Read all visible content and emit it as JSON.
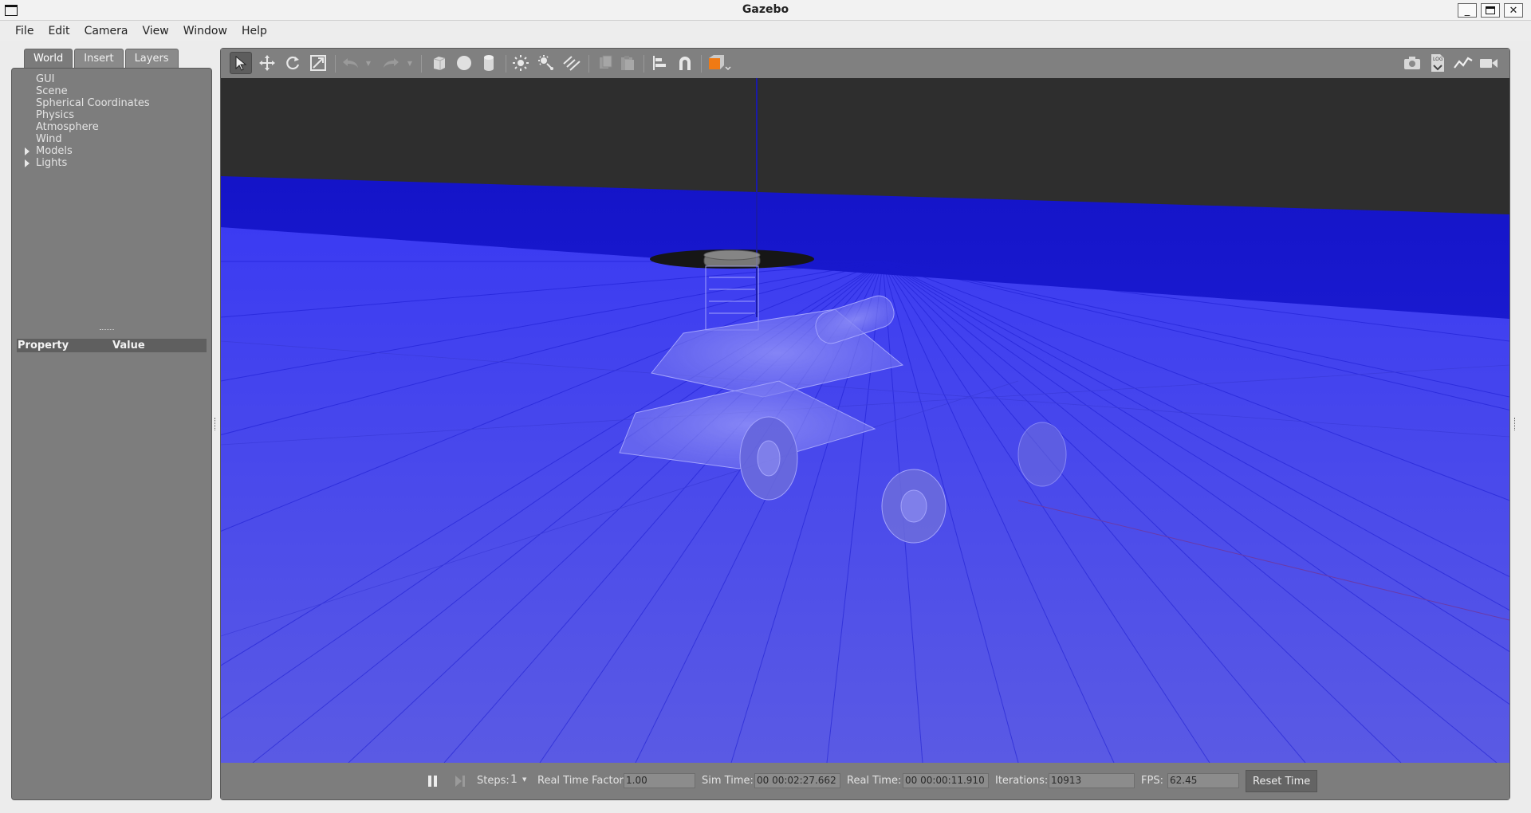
{
  "window": {
    "title": "Gazebo"
  },
  "menubar": {
    "items": [
      "File",
      "Edit",
      "Camera",
      "View",
      "Window",
      "Help"
    ]
  },
  "left_panel": {
    "tabs": [
      "World",
      "Insert",
      "Layers"
    ],
    "active_tab": "World",
    "tree": [
      "GUI",
      "Scene",
      "Spherical Coordinates",
      "Physics",
      "Atmosphere",
      "Wind",
      "Models",
      "Lights"
    ],
    "properties": {
      "col_property": "Property",
      "col_value": "Value"
    }
  },
  "toolbar": {
    "icons": [
      "select-mode-icon",
      "translate-mode-icon",
      "rotate-mode-icon",
      "scale-mode-icon",
      "undo-icon",
      "redo-icon",
      "box-shape-icon",
      "sphere-shape-icon",
      "cylinder-shape-icon",
      "point-light-icon",
      "spot-light-icon",
      "directional-light-icon",
      "copy-icon",
      "paste-icon",
      "align-icon",
      "snap-icon",
      "view-angle-icon",
      "screenshot-icon",
      "log-icon",
      "plot-icon",
      "record-video-icon"
    ]
  },
  "bottom_bar": {
    "steps_label": "Steps:",
    "steps_value": "1",
    "rtf_label": "Real Time Factor:",
    "rtf_value": "1.00",
    "sim_time_label": "Sim Time:",
    "sim_time_value": "00 00:02:27.662",
    "real_time_label": "Real Time:",
    "real_time_value": "00 00:00:11.910",
    "iterations_label": "Iterations:",
    "iterations_value": "10913",
    "fps_label": "FPS:",
    "fps_value": "62.45",
    "reset_label": "Reset Time"
  },
  "colors": {
    "ground": "#3d3df0",
    "sky": "#2e2e2e",
    "panel": "#7d7d7d"
  }
}
